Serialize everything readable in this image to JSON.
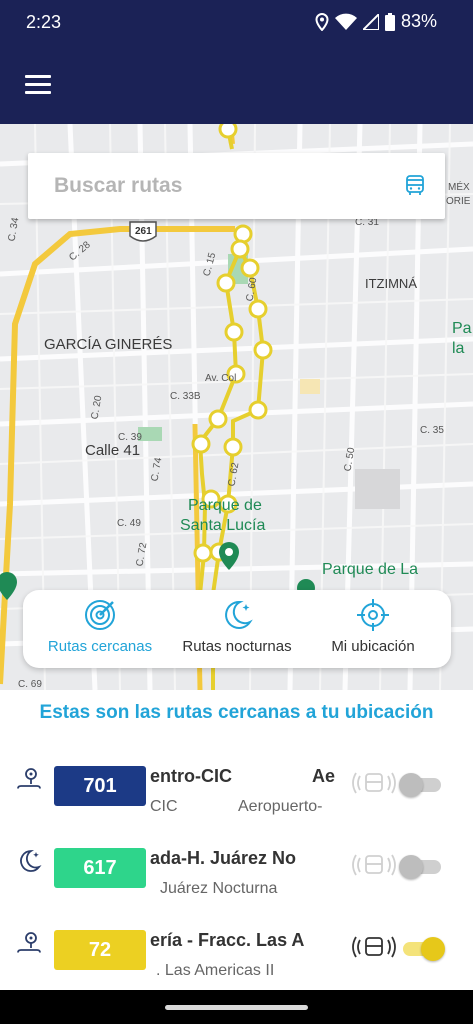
{
  "status_bar": {
    "time": "2:23",
    "battery": "83%",
    "icons": [
      "location-icon",
      "wifi-icon",
      "signal-icon",
      "battery-icon"
    ]
  },
  "app_bar": {
    "menu_icon": "hamburger-menu-icon"
  },
  "search": {
    "placeholder": "Buscar rutas",
    "icon": "bus-icon"
  },
  "map": {
    "labels": {
      "garcia_gineres": "GARCÍA GINERÉS",
      "itzimna": "ITZIMNÁ",
      "calle_41": "Calle 41",
      "parque_santa_lucia_1": "Parque de",
      "parque_santa_lucia_2": "Santa Lucía",
      "parque_la_mejorada": "Parque de La",
      "mexico_1": "MÉX",
      "mexico_2": "ORIE",
      "pa": "Pa",
      "la": "la",
      "highway": "261",
      "c34": "C. 34",
      "c28": "C. 28",
      "c15": "C. 15",
      "c60": "C. 60",
      "c31": "C. 31",
      "c20": "C. 20",
      "c33b": "C. 33B",
      "c39": "C. 39",
      "c74": "C. 74",
      "c62": "C. 62",
      "c49": "C. 49",
      "c72": "C. 72",
      "c35": "C. 35",
      "c50": "C. 50",
      "c69": "C. 69",
      "av_col": "Av. Col"
    }
  },
  "actions": [
    {
      "label": "Rutas cercanas",
      "icon": "nearby-routes-icon",
      "active": true
    },
    {
      "label": "Rutas nocturnas",
      "icon": "night-routes-icon",
      "active": false
    },
    {
      "label": "Mi ubicación",
      "icon": "my-location-icon",
      "active": false
    }
  ],
  "panel": {
    "title": "Estas son las rutas cercanas a tu ubicación"
  },
  "routes": [
    {
      "number": "701",
      "name": "entro-CIC",
      "name_right": "Ae",
      "subtitle": "CIC",
      "subtitle_right": "Aeropuerto-",
      "color": "#1c3a86",
      "type_icon": "route-pin-icon",
      "enabled": false
    },
    {
      "number": "617",
      "name": "ada-H. Juárez No",
      "name_right": "",
      "subtitle": "Juárez Nocturna",
      "subtitle_right": "",
      "color": "#2ed58b",
      "type_icon": "night-route-icon",
      "enabled": false
    },
    {
      "number": "72",
      "name": "ería - Fracc. Las A",
      "name_right": "",
      "subtitle": ". Las Americas II",
      "subtitle_right": "",
      "color": "#ecd022",
      "type_icon": "route-pin-icon",
      "enabled": true
    }
  ],
  "colors": {
    "brand_dark": "#1b2256",
    "accent": "#22a4d8",
    "route_line": "#e6cf2e"
  }
}
